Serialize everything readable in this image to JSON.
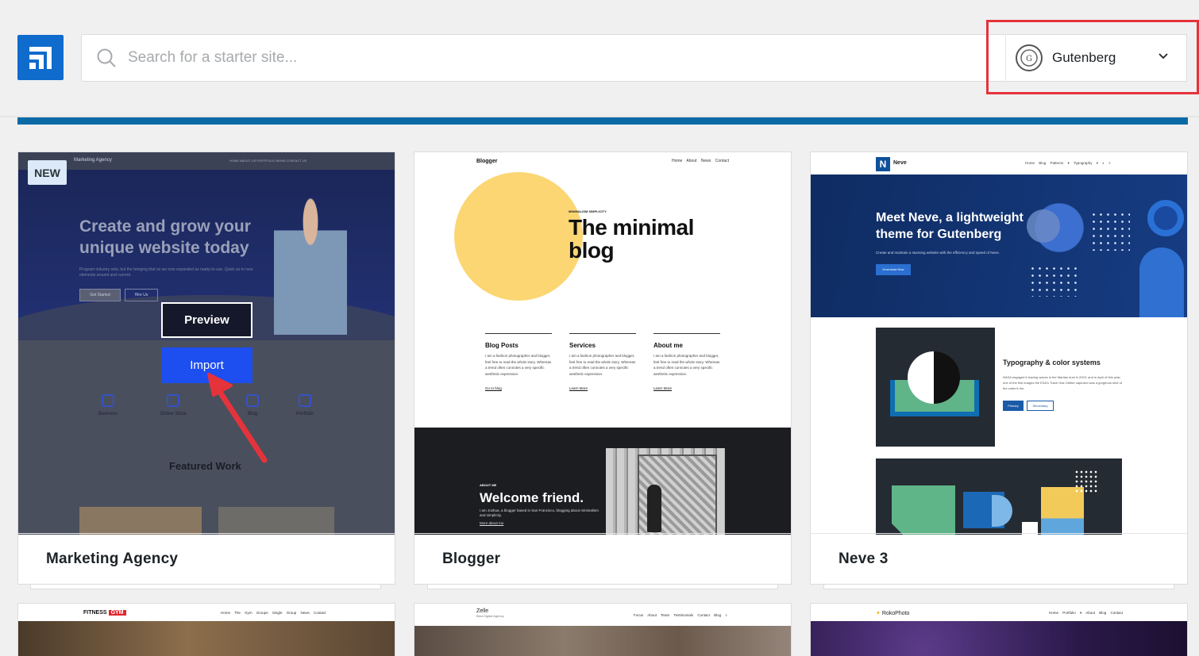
{
  "header": {
    "search_placeholder": "Search for a starter site...",
    "builder_label": "Gutenberg"
  },
  "badge_new": "NEW",
  "overlay": {
    "preview_label": "Preview",
    "import_label": "Import"
  },
  "cards": [
    {
      "name": "Marketing Agency",
      "thumb": {
        "logo": "Marketing Agency",
        "nav": "HOME  ABOUT US  PORTFOLIO  NEWS  CONTACT US",
        "headline_1": "Create and grow your",
        "headline_2": "unique website today",
        "paragraph": "Program industry sets, but the bringing that so we now expanded as ready-to-use. Quick as to new elements around and current.",
        "btn1": "Get Started",
        "btn2": "Hire Us",
        "services": [
          "Business",
          "Online Store",
          "Blog",
          "Portfolio"
        ],
        "featured": "Featured Work"
      }
    },
    {
      "name": "Blogger",
      "thumb": {
        "logo": "Blogger",
        "nav": "Home About News Contact",
        "kicker": "MINIMALISM SIMPLICITY",
        "title_1": "The minimal",
        "title_2": "blog",
        "columns": [
          {
            "heading": "Blog Posts",
            "text": "I am a fashion photographer and blogger, feel free to read the whole story. Whereas a trend often connotes a very specific aesthetic expression.",
            "link": "Go to blog"
          },
          {
            "heading": "Services",
            "text": "I am a fashion photographer and blogger, feel free to read the whole story. Whereas a trend often connotes a very specific aesthetic expression.",
            "link": "Learn More"
          },
          {
            "heading": "About me",
            "text": "I am a fashion photographer and blogger, feel free to read the whole story. Whereas a trend often connotes a very specific aesthetic expression.",
            "link": "Learn More"
          }
        ],
        "about_kicker": "ABOUT ME",
        "welcome": "Welcome friend.",
        "welcome_text": "I am Joshua, a blogger based in San Francisco, blogging about minimalism and simplicity.",
        "welcome_link": "More about me"
      }
    },
    {
      "name": "Neve 3",
      "thumb": {
        "logo_letter": "N",
        "logo": "Neve",
        "nav": "Home  Blog  Patterns ▾  Typography ▾  ◐  ⌕",
        "headline_1": "Meet Neve, a lightweight",
        "headline_2": "theme for Gutenberg",
        "paragraph": "Create and maintain a stunning website with the efficiency and speed of Neve.",
        "button": "Download Now",
        "section_title": "Typography & color systems",
        "section_text": "NASA engaged it leaving waves in the Martian dust in 2003, and in April of this year, one of the first images the ESA's Trace Gas Orbiter captured was a gorgeous shot of the crater's rim.",
        "primary": "Primary",
        "secondary": "Secondary"
      }
    }
  ],
  "row2": [
    {
      "logo_a": "FITNESS",
      "logo_b": "GYM",
      "nav": "Home  The Gym  Groups  Single Group  News  Contact"
    },
    {
      "logo": "Zelle",
      "sub": "Best Digital Agency",
      "nav": "Focus  About  Team  Testimonials  Contact  Blog  ⌕"
    },
    {
      "logo": "RokoPhoto",
      "nav": "Home  Portfolio ▾  About  Blog  Contact"
    }
  ],
  "colors": {
    "accent": "#1d4ef0",
    "progress": "#0b6aa6",
    "highlight": "#e5333b",
    "logo": "#0f6bcc"
  }
}
